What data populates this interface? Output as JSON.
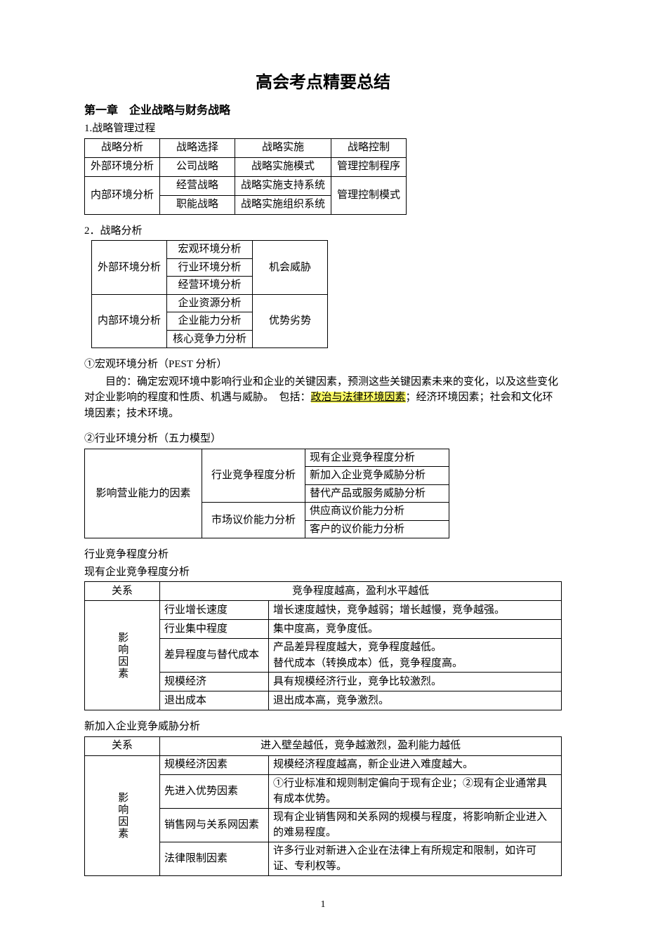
{
  "title": "高会考点精要总结",
  "chapter": "第一章　企业战略与财务战略",
  "sec1": {
    "heading": "1.战略管理过程",
    "row1": [
      "战略分析",
      "战略选择",
      "战略实施",
      "战略控制"
    ],
    "row2": [
      "外部环境分析",
      "公司战略",
      "战略实施模式",
      "管理控制程序"
    ],
    "row3": [
      "经营战略",
      "战略实施支持系统"
    ],
    "row4": [
      "内部环境分析",
      "职能战略",
      "战略实施组织系统",
      "管理控制模式"
    ]
  },
  "sec2": {
    "heading": "2．战略分析",
    "ext_label": "外部环境分析",
    "ext_items": [
      "宏观环境分析",
      "行业环境分析",
      "经营环境分析"
    ],
    "ext_right": "机会威胁",
    "int_label": "内部环境分析",
    "int_items": [
      "企业资源分析",
      "企业能力分析",
      "核心竞争力分析"
    ],
    "int_right": "优势劣势"
  },
  "pest": {
    "heading": "①宏观环境分析（PEST 分析）",
    "p_pre": "目的：确定宏观环境中影响行业和企业的关键因素，预测这些关键因素未来的变化，以及这些变化对企业影响的程度和性质、机遇与威胁。　包括：",
    "hl": "政治与法律环境因素",
    "p_post": "；经济环境因素；社会和文化环境因素；技术环境。"
  },
  "five": {
    "heading": "②行业环境分析（五力模型）",
    "left": "影响营业能力的因素",
    "mid1": "行业竞争程度分析",
    "r1": "现有企业竞争程度分析",
    "r2": "新加入企业竞争威胁分析",
    "r3": "替代产品或服务威胁分析",
    "mid2": "市场议价能力分析",
    "r4": "供应商议价能力分析",
    "r5": "客户的议价能力分析"
  },
  "comp_line1": "行业竞争程度分析",
  "comp_line2": "现有企业竞争程度分析",
  "tbl4": {
    "rel": "关系",
    "rel_desc": "竞争程度越高，盈利水平越低",
    "factor_label": "影响因素",
    "rows": [
      {
        "l": "行业增长速度",
        "d": "增长速度越快，竞争越弱；增长越慢，竞争越强。"
      },
      {
        "l": "行业集中程度",
        "d": "集中度高，竞争度低。"
      },
      {
        "l": "差异程度与替代成本",
        "d": "产品差异程度越大，竞争程度越低。\n替代成本（转换成本）低，竞争程度高。"
      },
      {
        "l": "规模经济",
        "d": "具有规模经济行业，竞争比较激烈。"
      },
      {
        "l": "退出成本",
        "d": "退出成本高，竞争激烈。"
      }
    ]
  },
  "new_line": "新加入企业竞争威胁分析",
  "tbl5": {
    "rel": "关系",
    "rel_desc": "进入壁垒越低，竞争越激烈，盈利能力越低",
    "factor_label": "影响因素",
    "rows": [
      {
        "l": "规模经济因素",
        "d": "规模经济程度越高，新企业进入难度越大。"
      },
      {
        "l": "先进入优势因素",
        "d": "①行业标准和规则制定偏向于现有企业；②现有企业通常具有成本优势。"
      },
      {
        "l": "销售网与关系网因素",
        "d": "现有企业销售网和关系网的规模与程度，将影响新企业进入的难易程度。"
      },
      {
        "l": "法律限制因素",
        "d": "许多行业对新进入企业在法律上有所规定和限制，如许可证、专利权等。"
      }
    ]
  },
  "page_num": "1"
}
